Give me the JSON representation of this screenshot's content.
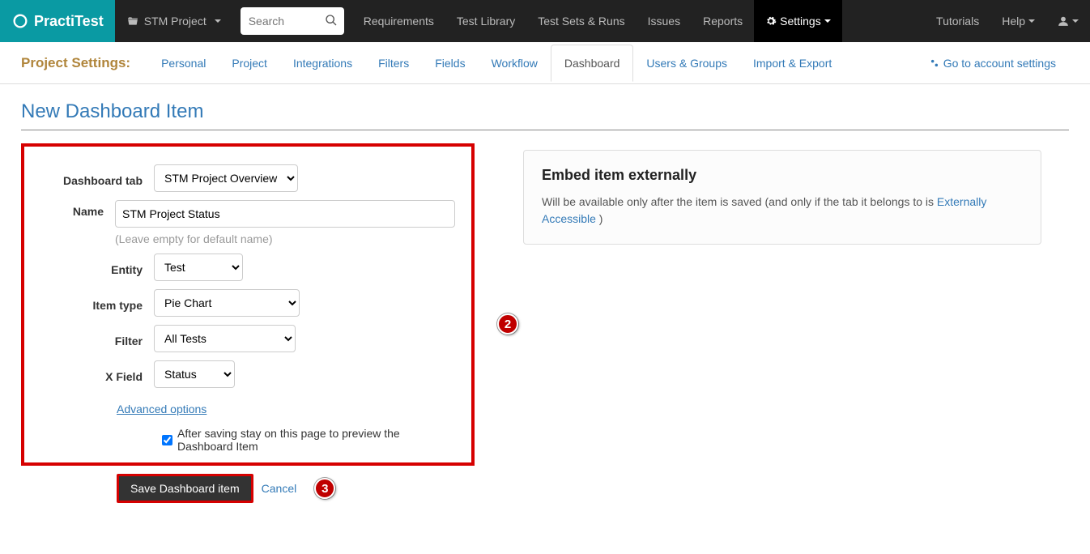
{
  "brand": "PractiTest",
  "project_name": "STM Project",
  "search_placeholder": "Search",
  "topnav": {
    "requirements": "Requirements",
    "test_library": "Test Library",
    "test_sets": "Test Sets & Runs",
    "issues": "Issues",
    "reports": "Reports",
    "settings": "Settings",
    "tutorials": "Tutorials",
    "help": "Help"
  },
  "subnav": {
    "title": "Project Settings:",
    "personal": "Personal",
    "project": "Project",
    "integrations": "Integrations",
    "filters": "Filters",
    "fields": "Fields",
    "workflow": "Workflow",
    "dashboard": "Dashboard",
    "users_groups": "Users & Groups",
    "import_export": "Import & Export",
    "account_settings": "Go to account settings"
  },
  "page_title": "New Dashboard Item",
  "form": {
    "dashboard_tab_label": "Dashboard tab",
    "dashboard_tab_value": "STM Project Overview",
    "name_label": "Name",
    "name_value": "STM Project Status",
    "name_hint": "(Leave empty for default name)",
    "entity_label": "Entity",
    "entity_value": "Test",
    "item_type_label": "Item type",
    "item_type_value": "Pie Chart",
    "filter_label": "Filter",
    "filter_value": "All Tests",
    "xfield_label": "X Field",
    "xfield_value": "Status",
    "advanced": "Advanced options",
    "stay_label": "After saving stay on this page to preview the Dashboard Item",
    "save_btn": "Save Dashboard item",
    "cancel": "Cancel"
  },
  "panel": {
    "title": "Embed item externally",
    "body_pre": "Will be available only after the item is saved (and only if the tab it belongs to is ",
    "link": "Externally Accessible",
    "body_post": " )"
  },
  "badges": {
    "b2": "2",
    "b3": "3"
  }
}
